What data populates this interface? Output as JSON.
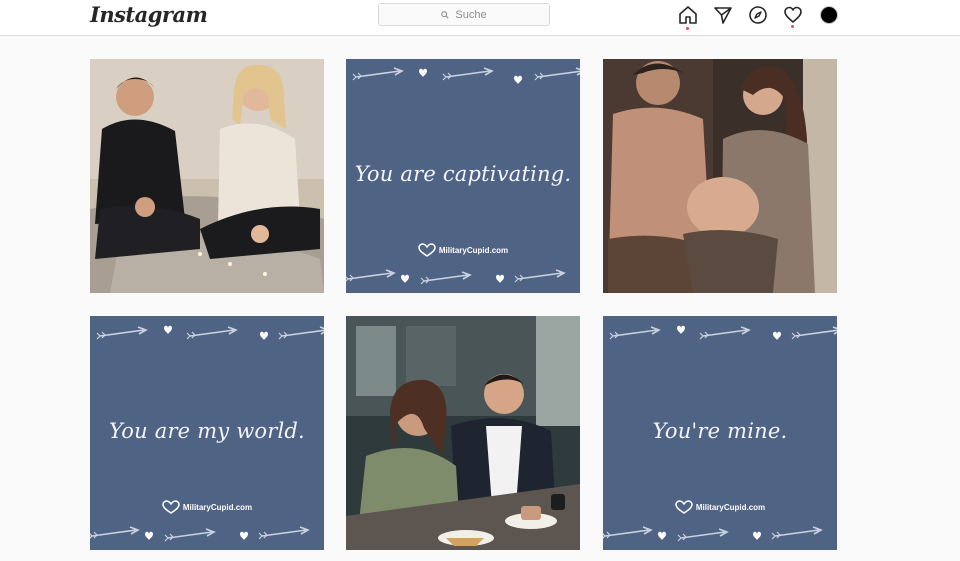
{
  "header": {
    "logo": "Instagram",
    "search_placeholder": "Suche",
    "icons": [
      "home-icon",
      "direct-send-icon",
      "explore-compass-icon",
      "activity-heart-icon",
      "profile-avatar"
    ]
  },
  "colors": {
    "quote_card_bg": "#4f6384",
    "notification_dot": "#ed4956"
  },
  "grid": {
    "posts": [
      {
        "kind": "photo",
        "subject": "couple sitting on a bed"
      },
      {
        "kind": "quote",
        "quote": "You are captivating.",
        "brand": "MilitaryCupid.com"
      },
      {
        "kind": "photo",
        "subject": "expecting couple by a window"
      },
      {
        "kind": "quote",
        "quote": "You are my world.",
        "brand": "MilitaryCupid.com"
      },
      {
        "kind": "photo",
        "subject": "couple at a café table"
      },
      {
        "kind": "quote",
        "quote": "You're mine.",
        "brand": "MilitaryCupid.com"
      }
    ]
  }
}
